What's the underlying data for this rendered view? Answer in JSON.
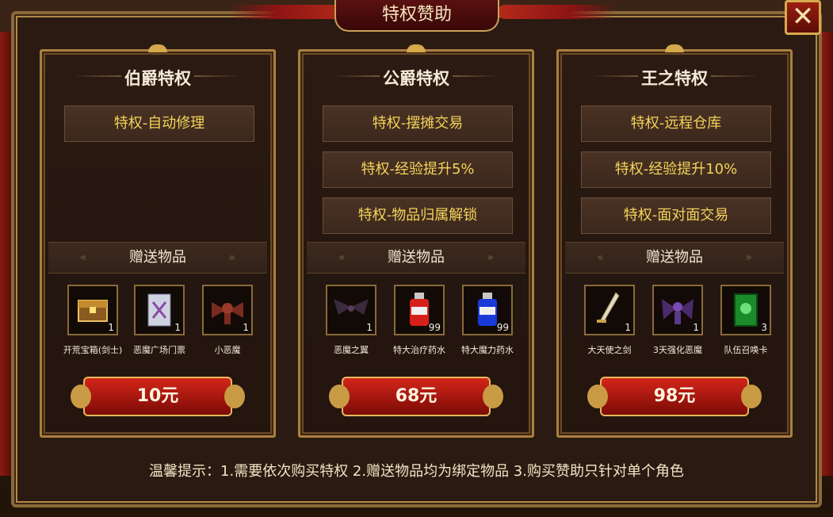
{
  "window": {
    "title": "特权赞助",
    "close_label": "✕"
  },
  "colors": {
    "accent_gold": "#f4d35a",
    "button_red": "#c81e14",
    "border_gold": "#a9803e"
  },
  "gift_section_label": "赠送物品",
  "cards": [
    {
      "title": "伯爵特权",
      "privileges": [
        "特权-自动修理"
      ],
      "items": [
        {
          "name": "开荒宝箱(剑士)",
          "count": "1",
          "icon": "treasure-chest-icon"
        },
        {
          "name": "恶魔广场门票",
          "count": "1",
          "icon": "ticket-icon"
        },
        {
          "name": "小恶魔",
          "count": "1",
          "icon": "imp-icon"
        }
      ],
      "price": "10元"
    },
    {
      "title": "公爵特权",
      "privileges": [
        "特权-摆摊交易",
        "特权-经验提升5%",
        "特权-物品归属解锁"
      ],
      "items": [
        {
          "name": "恶魔之翼",
          "count": "1",
          "icon": "demon-wings-icon"
        },
        {
          "name": "特大治疗药水",
          "count": "99",
          "icon": "red-potion-icon"
        },
        {
          "name": "特大魔力药水",
          "count": "99",
          "icon": "blue-potion-icon"
        }
      ],
      "price": "68元"
    },
    {
      "title": "王之特权",
      "privileges": [
        "特权-远程仓库",
        "特权-经验提升10%",
        "特权-面对面交易"
      ],
      "items": [
        {
          "name": "大天使之剑",
          "count": "1",
          "icon": "sword-icon"
        },
        {
          "name": "3天强化恶魔",
          "count": "1",
          "icon": "enhanced-demon-icon"
        },
        {
          "name": "队伍召唤卡",
          "count": "3",
          "icon": "summon-card-icon"
        }
      ],
      "price": "98元"
    }
  ],
  "tip": "温馨提示：1.需要依次购买特权 2.赠送物品均为绑定物品 3.购买赞助只针对单个角色"
}
